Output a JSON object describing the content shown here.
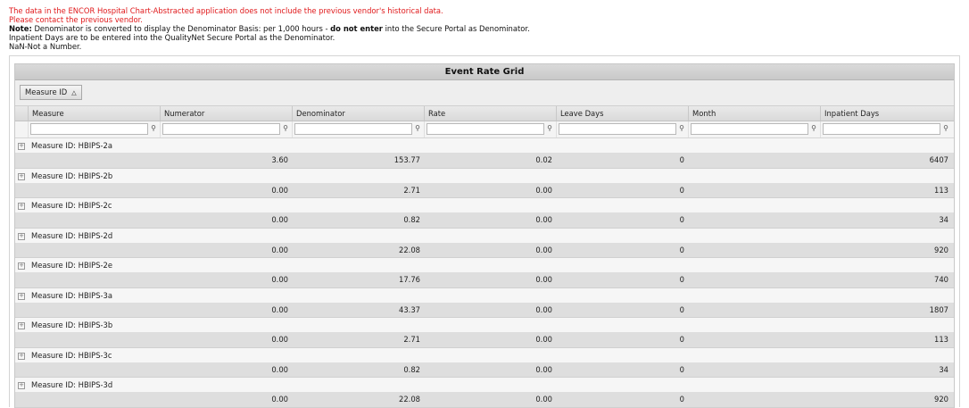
{
  "notes": {
    "line1": "The data in the ENCOR Hospital Chart-Abstracted application does not include the previous vendor's historical data.",
    "line2": "Please contact the previous vendor.",
    "note_label": "Note:",
    "note_text_a": " Denominator is converted to display the Denominator Basis: per 1,000 hours - ",
    "note_bold": "do not enter",
    "note_text_b": " into the Secure Portal as Denominator.",
    "line4": "Inpatient Days are to be entered into the QualityNet Secure Portal as the Denominator.",
    "line5": "NaN-Not a Number."
  },
  "grid": {
    "title": "Event Rate Grid",
    "group_chip": "Measure ID",
    "group_chip_arrow": "△",
    "columns": [
      "Measure",
      "Numerator",
      "Denominator",
      "Rate",
      "Leave Days",
      "Month",
      "Inpatient Days"
    ],
    "filter_icon": "⚲",
    "expander_symbol": "+",
    "groups": [
      {
        "label": "Measure ID: HBIPS-2a",
        "numerator": "3.60",
        "denominator": "153.77",
        "rate": "0.02",
        "leave_days": "0",
        "month": "",
        "inpatient_days": "6407"
      },
      {
        "label": "Measure ID: HBIPS-2b",
        "numerator": "0.00",
        "denominator": "2.71",
        "rate": "0.00",
        "leave_days": "0",
        "month": "",
        "inpatient_days": "113"
      },
      {
        "label": "Measure ID: HBIPS-2c",
        "numerator": "0.00",
        "denominator": "0.82",
        "rate": "0.00",
        "leave_days": "0",
        "month": "",
        "inpatient_days": "34"
      },
      {
        "label": "Measure ID: HBIPS-2d",
        "numerator": "0.00",
        "denominator": "22.08",
        "rate": "0.00",
        "leave_days": "0",
        "month": "",
        "inpatient_days": "920"
      },
      {
        "label": "Measure ID: HBIPS-2e",
        "numerator": "0.00",
        "denominator": "17.76",
        "rate": "0.00",
        "leave_days": "0",
        "month": "",
        "inpatient_days": "740"
      },
      {
        "label": "Measure ID: HBIPS-3a",
        "numerator": "0.00",
        "denominator": "43.37",
        "rate": "0.00",
        "leave_days": "0",
        "month": "",
        "inpatient_days": "1807"
      },
      {
        "label": "Measure ID: HBIPS-3b",
        "numerator": "0.00",
        "denominator": "2.71",
        "rate": "0.00",
        "leave_days": "0",
        "month": "",
        "inpatient_days": "113"
      },
      {
        "label": "Measure ID: HBIPS-3c",
        "numerator": "0.00",
        "denominator": "0.82",
        "rate": "0.00",
        "leave_days": "0",
        "month": "",
        "inpatient_days": "34"
      },
      {
        "label": "Measure ID: HBIPS-3d",
        "numerator": "0.00",
        "denominator": "22.08",
        "rate": "0.00",
        "leave_days": "0",
        "month": "",
        "inpatient_days": "920"
      }
    ]
  }
}
